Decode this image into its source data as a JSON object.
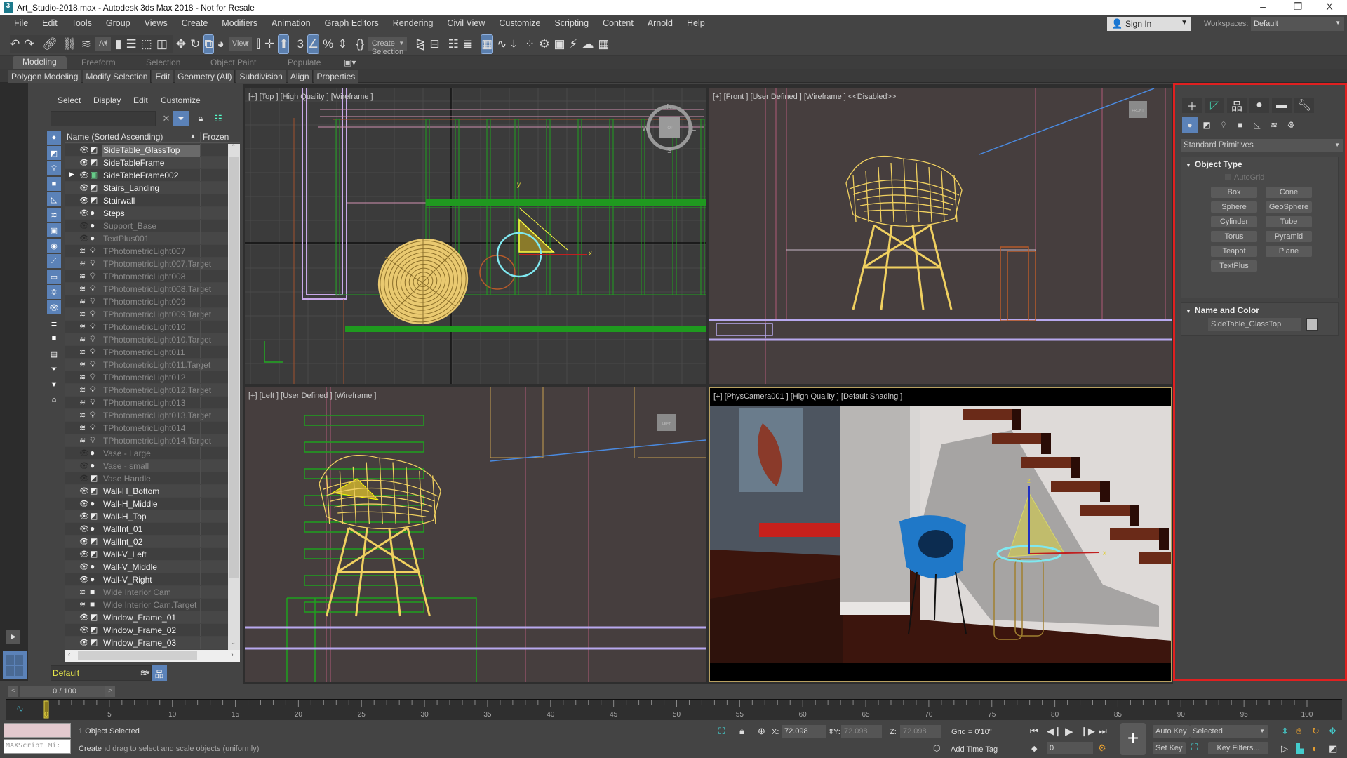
{
  "window": {
    "title": "Art_Studio-2018.max - Autodesk 3ds Max 2018 - Not for Resale",
    "minimize": "–",
    "maximize": "❐",
    "close": "X"
  },
  "menubar": {
    "items": [
      "File",
      "Edit",
      "Tools",
      "Group",
      "Views",
      "Create",
      "Modifiers",
      "Animation",
      "Graph Editors",
      "Rendering",
      "Civil View",
      "Customize",
      "Scripting",
      "Content",
      "Arnold",
      "Help"
    ],
    "sign_in": "Sign In",
    "workspaces_label": "Workspaces:",
    "workspace": "Default"
  },
  "toolbar": {
    "selection_filter": "All",
    "reference_coord": "View",
    "named_selection": "Create Selection Se",
    "icons": [
      "undo",
      "redo",
      "|",
      "select-and-link",
      "unlink-selection",
      "bind-to-space-warp",
      "DD:selection_filter",
      "select-object",
      "select-by-name",
      "rectangular-selection-region",
      "window-crossing",
      "|",
      "select-and-move",
      "select-and-rotate",
      "*select-and-scale",
      "select-and-place",
      "DD:reference_coord",
      "use-pivot-center",
      "select-and-manipulate",
      "*keyboard-shortcut-override",
      "|",
      "snaps-toggle",
      "*angle-snap-toggle",
      "percent-snap-toggle",
      "spinner-snap-toggle",
      "|",
      "edit-named-selection-sets",
      "DD:named_selection",
      "|",
      "mirror",
      "align",
      "|",
      "toggle-scene-explorer",
      "toggle-layer-explorer",
      "|",
      "*toggle-ribbon",
      "curve-editor",
      "schematic-view",
      "|",
      "material-editor",
      "render-setup",
      "rendered-frame-window",
      "render-production",
      "render-in-cloud",
      "a360-gallery"
    ]
  },
  "ribbon": {
    "tabs": [
      "Modeling",
      "Freeform",
      "Selection",
      "Object Paint",
      "Populate"
    ],
    "active_tab": "Modeling",
    "panels": [
      "Polygon Modeling",
      "Modify Selection",
      "Edit",
      "Geometry (All)",
      "Subdivision",
      "Align",
      "Properties"
    ]
  },
  "scene_explorer": {
    "menu": [
      "Select",
      "Display",
      "Edit",
      "Customize"
    ],
    "search_placeholder": "",
    "column_name": "Name (Sorted Ascending)",
    "column_frozen": "Frozen",
    "layer": "Default",
    "items": [
      {
        "name": "SideTable_GlassTop",
        "state": "visible",
        "type": "geo",
        "selected": true
      },
      {
        "name": "SideTableFrame",
        "state": "visible",
        "type": "geo"
      },
      {
        "name": "SideTableFrame002",
        "state": "visible",
        "type": "group",
        "expandable": true
      },
      {
        "name": "Stairs_Landing",
        "state": "visible",
        "type": "geo"
      },
      {
        "name": "Stairwall",
        "state": "visible",
        "type": "geo"
      },
      {
        "name": "Steps",
        "state": "visible",
        "type": "sphere"
      },
      {
        "name": "Support_Base",
        "state": "hidden",
        "type": "sphere"
      },
      {
        "name": "TextPlus001",
        "state": "hidden",
        "type": "sphere"
      },
      {
        "name": "TPhotometricLight007",
        "state": "layer",
        "type": "light"
      },
      {
        "name": "TPhotometricLight007.Target",
        "state": "layer",
        "type": "light"
      },
      {
        "name": "TPhotometricLight008",
        "state": "layer",
        "type": "light"
      },
      {
        "name": "TPhotometricLight008.Target",
        "state": "layer",
        "type": "light"
      },
      {
        "name": "TPhotometricLight009",
        "state": "layer",
        "type": "light"
      },
      {
        "name": "TPhotometricLight009.Target",
        "state": "layer",
        "type": "light"
      },
      {
        "name": "TPhotometricLight010",
        "state": "layer",
        "type": "light"
      },
      {
        "name": "TPhotometricLight010.Target",
        "state": "layer",
        "type": "light"
      },
      {
        "name": "TPhotometricLight011",
        "state": "layer",
        "type": "light"
      },
      {
        "name": "TPhotometricLight011.Target",
        "state": "layer",
        "type": "light"
      },
      {
        "name": "TPhotometricLight012",
        "state": "layer",
        "type": "light"
      },
      {
        "name": "TPhotometricLight012.Target",
        "state": "layer",
        "type": "light"
      },
      {
        "name": "TPhotometricLight013",
        "state": "layer",
        "type": "light"
      },
      {
        "name": "TPhotometricLight013.Target",
        "state": "layer",
        "type": "light"
      },
      {
        "name": "TPhotometricLight014",
        "state": "layer",
        "type": "light"
      },
      {
        "name": "TPhotometricLight014.Target",
        "state": "layer",
        "type": "light"
      },
      {
        "name": "Vase - Large",
        "state": "hidden",
        "type": "sphere"
      },
      {
        "name": "Vase - small",
        "state": "hidden",
        "type": "sphere"
      },
      {
        "name": "Vase Handle",
        "state": "hidden",
        "type": "geo"
      },
      {
        "name": "Wall-H_Bottom",
        "state": "visible",
        "type": "geo"
      },
      {
        "name": "Wall-H_Middle",
        "state": "visible",
        "type": "sphere"
      },
      {
        "name": "Wall-H_Top",
        "state": "visible",
        "type": "geo"
      },
      {
        "name": "WallInt_01",
        "state": "visible",
        "type": "sphere"
      },
      {
        "name": "WallInt_02",
        "state": "visible",
        "type": "geo"
      },
      {
        "name": "Wall-V_Left",
        "state": "visible",
        "type": "geo"
      },
      {
        "name": "Wall-V_Middle",
        "state": "visible",
        "type": "sphere"
      },
      {
        "name": "Wall-V_Right",
        "state": "visible",
        "type": "sphere"
      },
      {
        "name": "Wide Interior Cam",
        "state": "layer",
        "type": "camera"
      },
      {
        "name": "Wide Interior Cam.Target",
        "state": "layer",
        "type": "camera"
      },
      {
        "name": "Window_Frame_01",
        "state": "visible",
        "type": "geo"
      },
      {
        "name": "Window_Frame_02",
        "state": "visible",
        "type": "geo"
      },
      {
        "name": "Window_Frame_03",
        "state": "visible",
        "type": "geo"
      }
    ]
  },
  "viewports": {
    "top": {
      "label": "[+] [Top ] [High Quality ] [Wireframe ]",
      "compass": {
        "n": "N",
        "s": "S",
        "e": "E",
        "w": "W",
        "cube": "TOP"
      }
    },
    "front": {
      "label": "[+] [Front ] [User Defined ] [Wireframe ]  <<Disabled>>",
      "cube": "FRONT"
    },
    "left": {
      "label": "[+] [Left ] [User Defined ] [Wireframe ]",
      "cube": "LEFT"
    },
    "camera": {
      "label": "[+] [PhysCamera001 ] [High Quality ] [Default Shading ]"
    }
  },
  "command_panel": {
    "tabs": [
      "create",
      "modify",
      "hierarchy",
      "motion",
      "display",
      "utilities"
    ],
    "active_tab": "create",
    "categories": [
      "geometry",
      "shapes",
      "lights",
      "cameras",
      "helpers",
      "space-warps",
      "systems"
    ],
    "active_category": "geometry",
    "subcategory": "Standard Primitives",
    "object_type": {
      "title": "Object Type",
      "autogrid": "AutoGrid",
      "autogrid_checked": false,
      "buttons": [
        "Box",
        "Cone",
        "Sphere",
        "GeoSphere",
        "Cylinder",
        "Tube",
        "Torus",
        "Pyramid",
        "Teapot",
        "Plane",
        "TextPlus"
      ]
    },
    "name_and_color": {
      "title": "Name and Color",
      "name": "SideTable_GlassTop",
      "color": "#bdbdbd"
    }
  },
  "time_slider": {
    "label": "0 / 100",
    "prev": "<",
    "next": ">",
    "current": 0,
    "end": 100
  },
  "trackbar": {
    "start": 0,
    "end": 100,
    "label_step": 5
  },
  "status": {
    "maxscript": "MAXScript Mi:",
    "selection": "1 Object Selected",
    "prompt": "Click and drag to select and scale objects (uniformly)",
    "tooltip": "Create",
    "x_label": "X:",
    "x": "72.098",
    "y_label": "Y:",
    "y": "72.098",
    "z_label": "Z:",
    "z": "72.098",
    "grid": "Grid = 0'10\"",
    "add_time_tag": "Add Time Tag",
    "frame": "0",
    "auto_key": "Auto Key",
    "set_key": "Set Key",
    "key_mode": "Selected",
    "key_filters": "Key Filters..."
  },
  "colors": {
    "accent": "#5b82b8",
    "panel_highlight": "#e02020",
    "selection_wire": "#f0d060"
  }
}
